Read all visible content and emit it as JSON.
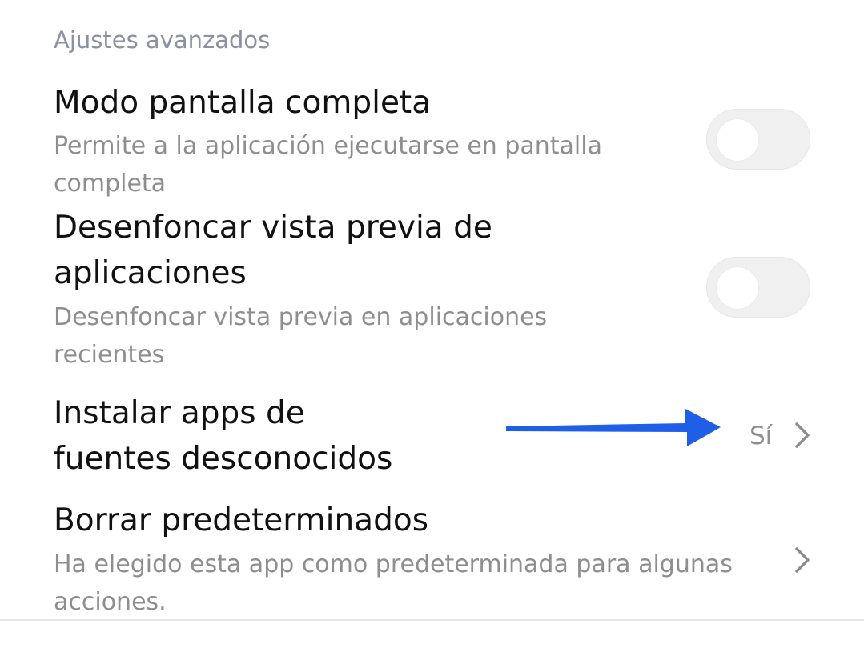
{
  "section": {
    "title": "Ajustes avanzados"
  },
  "settings": [
    {
      "title_lines": [
        "Modo pantalla completa"
      ],
      "description_lines": [
        "Permite a la aplicación ejecutarse en pantalla",
        "completa"
      ],
      "control": "toggle",
      "toggle_on": false
    },
    {
      "title_lines": [
        "Desenfoncar vista previa de",
        "aplicaciones"
      ],
      "description_lines": [
        "Desenfoncar vista previa en aplicaciones",
        "recientes"
      ],
      "control": "toggle",
      "toggle_on": false
    },
    {
      "title_lines": [
        "Instalar apps de",
        "fuentes desconocidos"
      ],
      "value": "Sí",
      "control": "chevron"
    },
    {
      "title_lines": [
        "Borrar predeterminados"
      ],
      "description_lines": [
        "Ha elegido esta app como predeterminada para algunas",
        "acciones."
      ],
      "control": "chevron"
    }
  ],
  "annotation": {
    "arrow_color": "#1f5fe8"
  },
  "colors": {
    "section_header": "#8a91a3",
    "title": "#111111",
    "description": "#8e8e8e",
    "toggle_track": "#f0f0f0"
  }
}
